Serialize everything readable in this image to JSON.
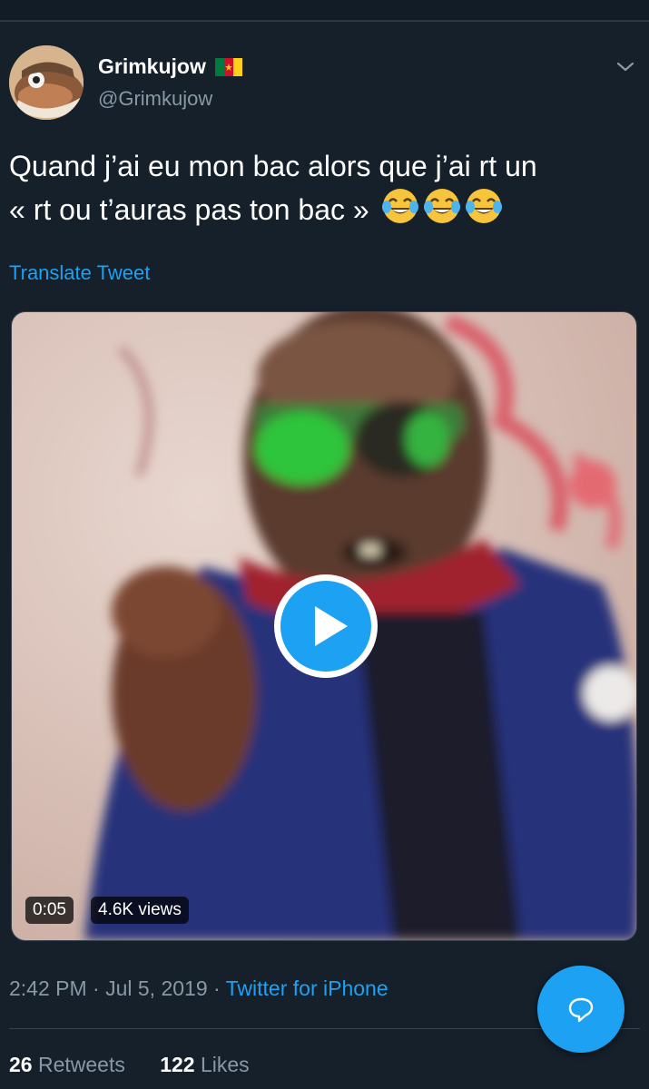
{
  "tweet": {
    "display_name": "Grimkujow",
    "handle": "@Grimkujow",
    "text_line1": "Quand j’ai eu mon bac alors que j’ai rt un",
    "text_line2": "« rt ou t’auras pas ton bac »",
    "translate_label": "Translate Tweet",
    "timestamp": "2:42 PM · Jul 5, 2019 · ",
    "source": "Twitter for iPhone",
    "retweets_count": "26",
    "retweets_label": " Retweets",
    "likes_count": "122",
    "likes_label": " Likes"
  },
  "video": {
    "duration": "0:05",
    "views": "4.6K views"
  },
  "icons": {
    "flag": "cameroon-flag-icon",
    "emoji": "tears-of-joy-emoji-icon",
    "chevron": "chevron-down-icon",
    "play": "play-icon",
    "compose": "compose-reply-icon"
  },
  "colors": {
    "background": "#15202b",
    "accent": "#1da1f2",
    "secondary_text": "#8899a6",
    "flag_green": "#007a3d",
    "flag_red": "#ce1126",
    "flag_yellow": "#fcd116"
  }
}
